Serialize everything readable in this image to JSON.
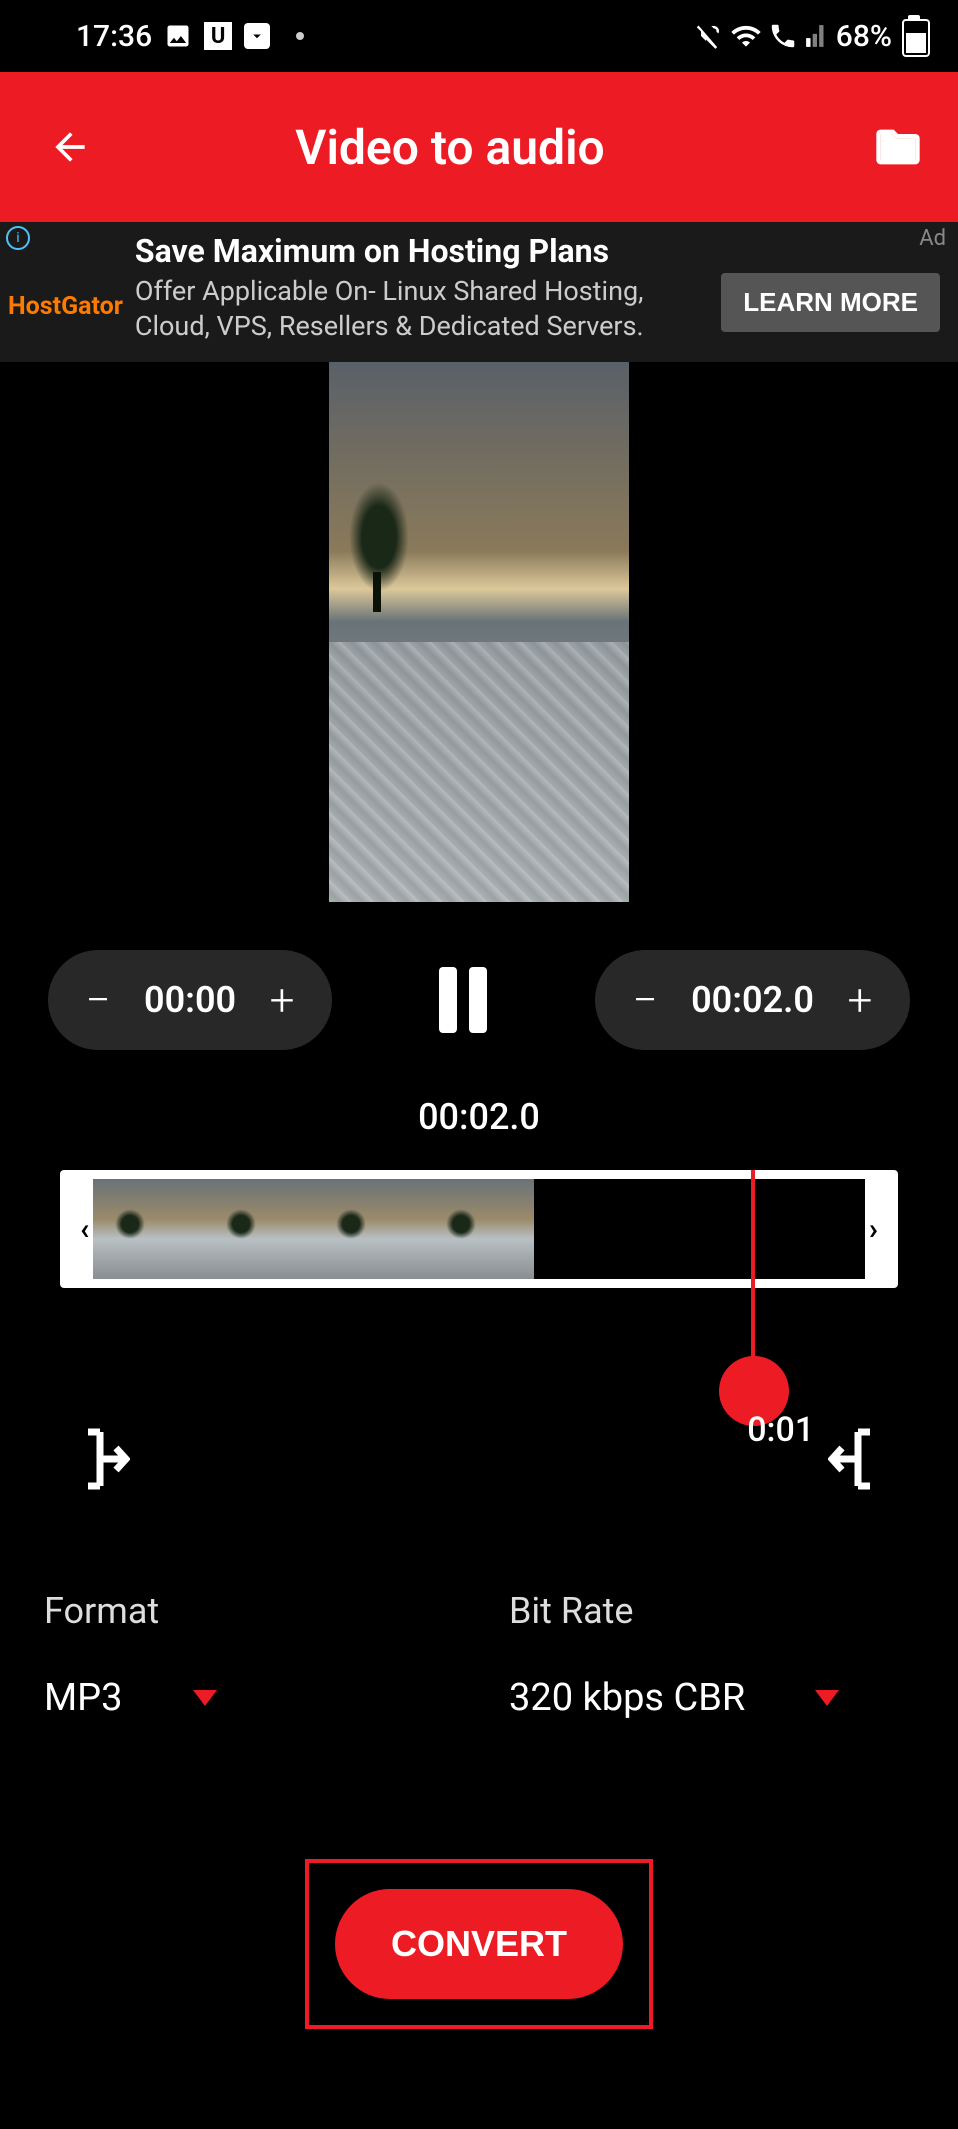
{
  "status": {
    "time": "17:36",
    "battery": "68%"
  },
  "header": {
    "title": "Video to audio"
  },
  "ad": {
    "label": "Ad",
    "brand": "HostGator",
    "title": "Save Maximum on Hosting Plans",
    "subtitle": "Offer Applicable On- Linux Shared Hosting, Cloud, VPS, Resellers & Dedicated Servers.",
    "cta": "LEARN MORE"
  },
  "controls": {
    "start_time": "00:00",
    "end_time": "00:02.0",
    "current_time": "00:02.0",
    "playhead_label": "0:01"
  },
  "options": {
    "format_label": "Format",
    "format_value": "MP3",
    "bitrate_label": "Bit Rate",
    "bitrate_value": "320 kbps CBR"
  },
  "convert": {
    "label": "CONVERT"
  }
}
